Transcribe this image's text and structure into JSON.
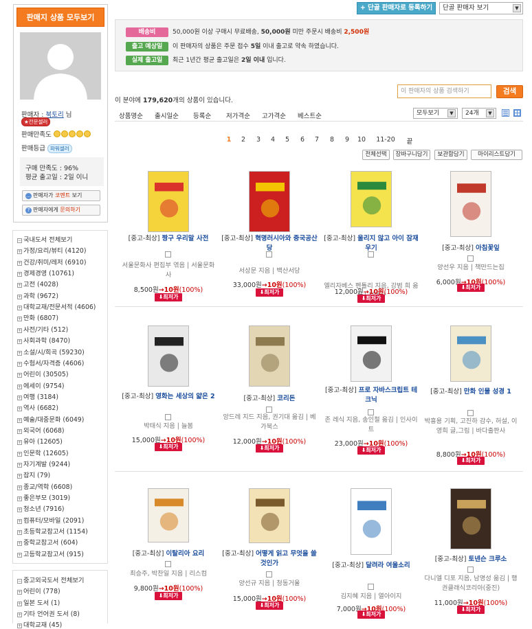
{
  "seller": {
    "title": "판매지 상품 모두보기",
    "name_prefix": "판매자 :",
    "name": "북토리",
    "name_suffix": "님",
    "badge": "전문셀러",
    "satisfaction_label": "판매만족도",
    "grade_label": "판매등급",
    "grade_badge": "파워셀러",
    "buy_satisfaction": "구매 만족도 : 96%",
    "avg_ship": "평균 출고일 : 2일 이니",
    "btn_comment_pre": "판매자가",
    "btn_comment_hl": "코멘트",
    "btn_comment_post": "보기",
    "btn_ask_pre": "판매자에게",
    "btn_ask_hl": "문의하기"
  },
  "categories_domestic": [
    {
      "label": "국내도서 전체보기"
    },
    {
      "label": "가정/요리/뷰티 (4120)"
    },
    {
      "label": "건강/취미/레저 (6910)"
    },
    {
      "label": "경제경영 (10761)"
    },
    {
      "label": "고전 (4028)"
    },
    {
      "label": "과학 (9672)"
    },
    {
      "label": "대학교재/전문서적 (4606)"
    },
    {
      "label": "만화 (6807)"
    },
    {
      "label": "사전/기타 (512)"
    },
    {
      "label": "사회과학 (8470)"
    },
    {
      "label": "소설/시/희곡 (59230)"
    },
    {
      "label": "수험서/자격증 (4606)"
    },
    {
      "label": "어린이 (30505)"
    },
    {
      "label": "에세이 (9754)"
    },
    {
      "label": "여행 (3184)"
    },
    {
      "label": "역사 (6682)"
    },
    {
      "label": "예술/대중문화 (6049)"
    },
    {
      "label": "외국어 (6068)"
    },
    {
      "label": "유아 (12605)"
    },
    {
      "label": "인문학 (12605)"
    },
    {
      "label": "자기계발 (9244)"
    },
    {
      "label": "잡지 (79)"
    },
    {
      "label": "종교/역학 (6608)"
    },
    {
      "label": "좋은부모 (3019)"
    },
    {
      "label": "청소년 (7916)"
    },
    {
      "label": "컴퓨터/모바일 (2091)"
    },
    {
      "label": "초등학교참고서 (1154)"
    },
    {
      "label": "중학교참고서 (604)"
    },
    {
      "label": "고등학교참고서 (915)"
    }
  ],
  "categories_foreign": [
    {
      "label": "중고외국도서 전체보기"
    },
    {
      "label": "어린이 (778)"
    },
    {
      "label": "일본 도서 (1)"
    },
    {
      "label": "기타 언어권 도서 (8)"
    },
    {
      "label": "대학교재 (45)"
    }
  ],
  "top": {
    "register_btn": "+ 단골 판매자로 등록하기",
    "view_select": "단골 판매자 보기"
  },
  "info": [
    {
      "pill": "배송비",
      "color": "#e5689a",
      "text_pre": "50,000원 이상 구매시 무료배송,",
      "bold": "50,000원",
      "text_mid": "미만 주문시 배송비",
      "red": "2,500원",
      "text_post": ""
    },
    {
      "pill": "출고 예상일",
      "color": "#55a84f",
      "text_pre": "이 판매자의 상품은 주문 접수",
      "bold": "5일",
      "text_mid": "이내 출고로 약속 하였습니다.",
      "red": "",
      "text_post": ""
    },
    {
      "pill": "실제 출고일",
      "color": "#55a84f",
      "text_pre": "최근 1년간 평균 출고일은",
      "bold": "2일 이내",
      "text_mid": "입니다.",
      "red": "",
      "text_post": ""
    }
  ],
  "listing": {
    "count_pre": "이 분야에",
    "count": "179,620",
    "count_post": "개의 상품이 있습니다.",
    "search_placeholder": "이 판매자의 상품 검색하기",
    "search_btn": "검색"
  },
  "sort_tabs": [
    "상품명순",
    "출시일순",
    "등록순",
    "저가격순",
    "고가격순",
    "베스트순"
  ],
  "filter_select": "모두보기",
  "per_page_select": "24개",
  "pages": [
    "1",
    "2",
    "3",
    "4",
    "5",
    "6",
    "7",
    "8",
    "9",
    "10",
    "11-20",
    "끝"
  ],
  "actions": [
    "전체선택",
    "장바구니담기",
    "보관함담기",
    "마이리스트담기"
  ],
  "products": [
    {
      "cond": "[중고-최상]",
      "title": "짱구 우리말 사전",
      "author": "서울문화사 편집부 엮음 | 서울문화사",
      "orig": "8,500원",
      "price": "10원",
      "pct": "(100%)",
      "cover": "#f5d33b",
      "accent": "#d9332b"
    },
    {
      "cond": "[중고-최상]",
      "title": "혁명러시아와 중국공산당",
      "author": "서상문 지음 | 백산서당",
      "orig": "33,000원",
      "price": "10원",
      "pct": "(100%)",
      "cover": "#cc1f1f",
      "accent": "#f2c500"
    },
    {
      "cond": "[중고-최상]",
      "title": "울리지 않고 아이 잠재우기",
      "author": "엘리자베스 펜틀리 지음, 강범 희 옮김 | 길엣사",
      "orig": "12,000원",
      "price": "10원",
      "pct": "(100%)",
      "cover": "#f4e34c",
      "accent": "#2b8a3e"
    },
    {
      "cond": "[중고-최상]",
      "title": "아침꽃잎",
      "author": "양선우 지음 | 책만드는집",
      "orig": "6,000원",
      "price": "10원",
      "pct": "(100%)",
      "cover": "#f6f1ea",
      "accent": "#c0392b"
    },
    {
      "cond": "[중고-최상]",
      "title": "영화는 세상의 얇은 2",
      "author": "박태식 지음 | 늘봄",
      "orig": "15,000원",
      "price": "10원",
      "pct": "(100%)",
      "cover": "#e9e9e9",
      "accent": "#222222"
    },
    {
      "cond": "[중고-최상]",
      "title": "코리돈",
      "author": "앙드레 지드 지음, 권기대 옮김 | 베가북스",
      "orig": "12,000원",
      "price": "10원",
      "pct": "(100%)",
      "cover": "#e2d6b5",
      "accent": "#8d7b4f"
    },
    {
      "cond": "[중고-최상]",
      "title": "프로 자바스크립트 테크닉",
      "author": "존 레식 지음, 송인철 옮김 | 인사이트",
      "orig": "23,000원",
      "price": "10원",
      "pct": "(100%)",
      "cover": "#f2f2f2",
      "accent": "#111111"
    },
    {
      "cond": "[중고-최상]",
      "title": "만화 인물 성경 1",
      "author": "박흥용 기획, 고진하 감수, 허설, 이영희 글,그림 | 바다출판사",
      "orig": "8,800원",
      "price": "10원",
      "pct": "(100%)",
      "cover": "#f3ead2",
      "accent": "#4a90c2"
    },
    {
      "cond": "[중고-최상]",
      "title": "이탈리아 요리",
      "author": "최승주, 박찬일 지음 | 리스컴",
      "orig": "9,800원",
      "price": "10원",
      "pct": "(100%)",
      "cover": "#f4f0e6",
      "accent": "#d8892a"
    },
    {
      "cond": "[중고-최상]",
      "title": "어떻게 읽고 무엇을 쓸 것인가",
      "author": "양선규 지음 | 청동거울",
      "orig": "15,000원",
      "price": "10원",
      "pct": "(100%)",
      "cover": "#f3e2b5",
      "accent": "#7a5a2a"
    },
    {
      "cond": "[중고-최상]",
      "title": "달려라 여울소리",
      "author": "김지혜 지음 | 열아이지",
      "orig": "7,000원",
      "price": "10원",
      "pct": "(100%)",
      "cover": "#ffffff",
      "accent": "#3f7fbf"
    },
    {
      "cond": "[중고-최상]",
      "title": "토넨슨 크루소",
      "author": "다니엘 디포 지음, 남명성 옮김 | 행권클래식코리아(중진)",
      "orig": "11,000원",
      "price": "10원",
      "pct": "(100%)",
      "cover": "#3a2a20",
      "accent": "#c7a15a"
    }
  ],
  "lowest_btn": "최저가",
  "arrow": "→"
}
